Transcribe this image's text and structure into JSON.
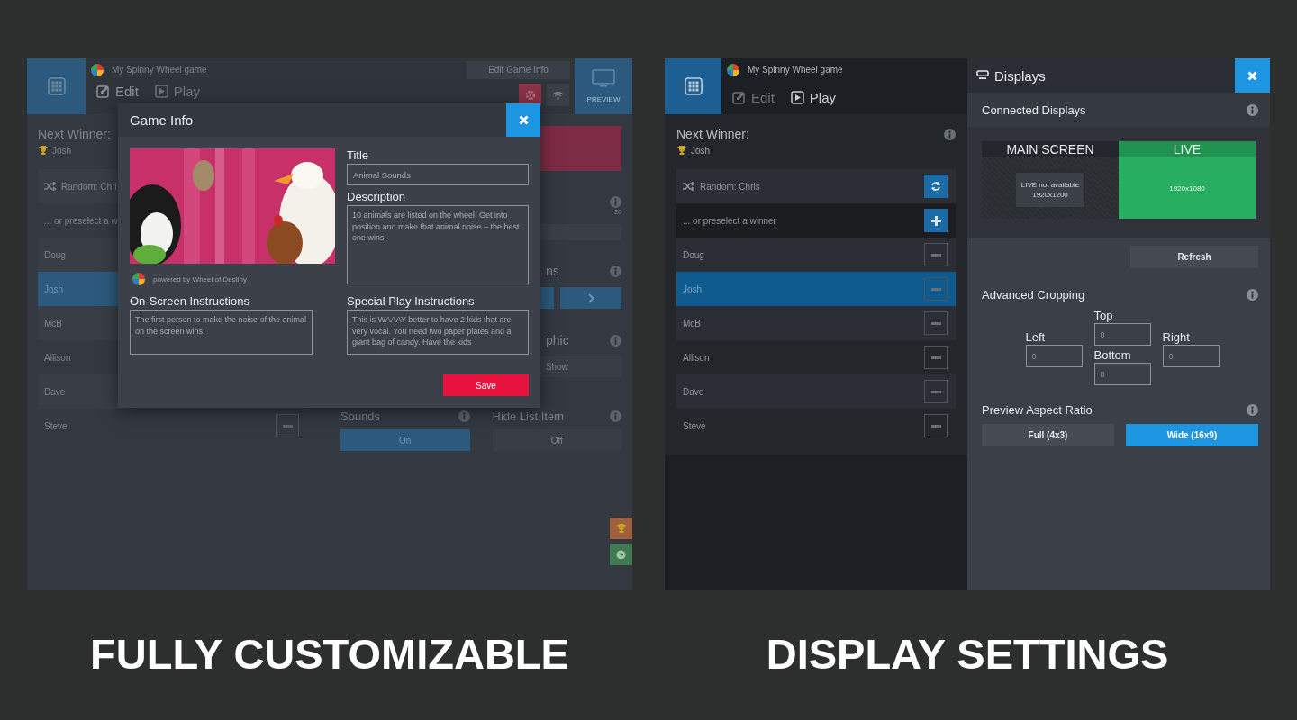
{
  "left_screen": {
    "app": {
      "game_title": "My Spinny Wheel game",
      "edit_info_button": "Edit Game Info",
      "preview_label": "PREVIEW",
      "tabs": [
        {
          "label": "Edit",
          "selected": true
        },
        {
          "label": "Play",
          "selected": false
        }
      ],
      "next_winner_label": "Next Winner:",
      "next_winner": "Josh",
      "random_label": "Random: Chri",
      "preselect_placeholder": "... or preselect a w",
      "players": [
        {
          "name": "Doug",
          "selected": false
        },
        {
          "name": "Josh",
          "selected": true
        },
        {
          "name": "McB",
          "selected": false
        },
        {
          "name": "Allison",
          "selected": false
        },
        {
          "name": "Dave",
          "selected": false
        },
        {
          "name": "Steve",
          "selected": false,
          "remove_button": true
        }
      ],
      "count": "20",
      "label_1": "ns",
      "label_2": "phic",
      "show_button": "Show",
      "toggles": [
        {
          "label": "Sounds",
          "value": "On",
          "on": true
        },
        {
          "label": "Hide List Item",
          "value": "Off",
          "on": false
        }
      ]
    },
    "modal": {
      "title": "Game Info",
      "powered_by": "powered by Wheel of Destiny",
      "fields": [
        {
          "label": "Title",
          "value": "Animal Sounds",
          "kind": "input"
        },
        {
          "label": "Description",
          "value": "10 animals are listed on the wheel. Get into position and make that animal noise – the best one wins!",
          "kind": "textarea"
        }
      ],
      "instructions": [
        {
          "label": "On-Screen Instructions",
          "value": "The first person to make the noise of the animal on the screen wins!"
        },
        {
          "label": "Special Play Instructions",
          "value": "This is WAAAY better to have 2 kids that are very vocal. You need two paper plates and a giant bag of candy. Have the kids"
        }
      ],
      "save_button": "Save"
    },
    "caption": "FULLY CUSTOMIZABLE"
  },
  "right_screen": {
    "app": {
      "game_title": "My Spinny Wheel game",
      "tabs": [
        {
          "label": "Edit",
          "selected": false
        },
        {
          "label": "Play",
          "selected": true
        }
      ],
      "next_winner_label": "Next Winner:",
      "next_winner": "Josh",
      "random_label": "Random: Chris",
      "preselect_placeholder": "... or preselect a winner",
      "players": [
        {
          "name": "Doug",
          "selected": false,
          "remove_button": true
        },
        {
          "name": "Josh",
          "selected": true,
          "remove_button": true
        },
        {
          "name": "McB",
          "selected": false,
          "remove_button": true
        },
        {
          "name": "Allison",
          "selected": false,
          "remove_button": true
        },
        {
          "name": "Dave",
          "selected": false,
          "remove_button": true
        },
        {
          "name": "Steve",
          "selected": false,
          "remove_button": true
        }
      ]
    },
    "displays_panel": {
      "title": "Displays",
      "connected_label": "Connected Displays",
      "displays": [
        {
          "label": "MAIN SCREEN",
          "status": "LIVE not available",
          "resolution": "1920x1200",
          "live": false
        },
        {
          "label": "LIVE",
          "resolution": "1920x1080",
          "live": true
        }
      ],
      "refresh_button": "Refresh",
      "cropping_label": "Advanced Cropping",
      "crop_fields": [
        {
          "label": "Top",
          "value": "0"
        },
        {
          "label": "Left",
          "value": "0"
        },
        {
          "label": "Right",
          "value": "0"
        },
        {
          "label": "Bottom",
          "value": "0"
        }
      ],
      "aspect_label": "Preview Aspect Ratio",
      "aspect_options": [
        {
          "label": "Full (4x3)",
          "selected": false
        },
        {
          "label": "Wide (16x9)",
          "selected": true
        }
      ]
    },
    "caption": "DISPLAY SETTINGS"
  }
}
